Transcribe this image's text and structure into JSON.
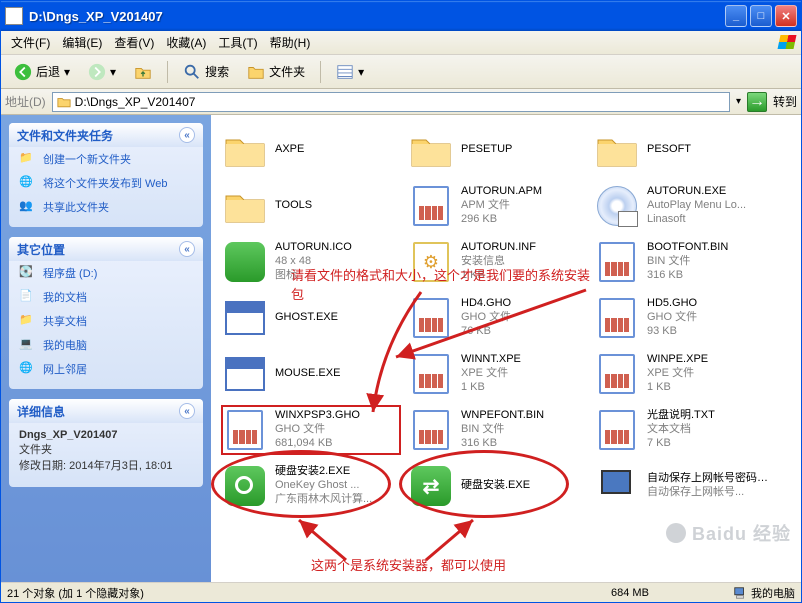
{
  "window": {
    "title": "D:\\Dngs_XP_V201407"
  },
  "menu": {
    "file": "文件(F)",
    "edit": "编辑(E)",
    "view": "查看(V)",
    "favorites": "收藏(A)",
    "tools": "工具(T)",
    "help": "帮助(H)"
  },
  "toolbar": {
    "back": "后退",
    "search": "搜索",
    "folders": "文件夹"
  },
  "address": {
    "label": "地址(D)",
    "path": "D:\\Dngs_XP_V201407",
    "go": "转到"
  },
  "sidebar": {
    "tasks": {
      "title": "文件和文件夹任务",
      "items": [
        "创建一个新文件夹",
        "将这个文件夹发布到 Web",
        "共享此文件夹"
      ]
    },
    "other": {
      "title": "其它位置",
      "items": [
        "程序盘 (D:)",
        "我的文档",
        "共享文档",
        "我的电脑",
        "网上邻居"
      ]
    },
    "detail": {
      "title": "详细信息",
      "name": "Dngs_XP_V201407",
      "type": "文件夹",
      "mod_label": "修改日期:",
      "mod_value": "2014年7月3日, 18:01"
    }
  },
  "items": [
    {
      "icon": "folder",
      "name": "AXPE",
      "sub1": "",
      "sub2": ""
    },
    {
      "icon": "folder",
      "name": "PESETUP",
      "sub1": "",
      "sub2": ""
    },
    {
      "icon": "folder",
      "name": "PESOFT",
      "sub1": "",
      "sub2": ""
    },
    {
      "icon": "folder",
      "name": "TOOLS",
      "sub1": "",
      "sub2": ""
    },
    {
      "icon": "file",
      "name": "AUTORUN.APM",
      "sub1": "APM 文件",
      "sub2": "296 KB"
    },
    {
      "icon": "disc",
      "name": "AUTORUN.EXE",
      "sub1": "AutoPlay Menu Lo...",
      "sub2": "Linasoft"
    },
    {
      "icon": "ico-green",
      "name": "AUTORUN.ICO",
      "sub1": "48 x 48",
      "sub2": "图标"
    },
    {
      "icon": "file-yellow",
      "name": "AUTORUN.INF",
      "sub1": "安装信息",
      "sub2": "1 KB"
    },
    {
      "icon": "file",
      "name": "BOOTFONT.BIN",
      "sub1": "BIN 文件",
      "sub2": "316 KB"
    },
    {
      "icon": "exe",
      "name": "GHOST.EXE",
      "sub1": "",
      "sub2": ""
    },
    {
      "icon": "file",
      "name": "HD4.GHO",
      "sub1": "GHO 文件",
      "sub2": "76 KB"
    },
    {
      "icon": "file",
      "name": "HD5.GHO",
      "sub1": "GHO 文件",
      "sub2": "93 KB"
    },
    {
      "icon": "exe",
      "name": "MOUSE.EXE",
      "sub1": "",
      "sub2": ""
    },
    {
      "icon": "file",
      "name": "WINNT.XPE",
      "sub1": "XPE 文件",
      "sub2": "1 KB"
    },
    {
      "icon": "file",
      "name": "WINPE.XPE",
      "sub1": "XPE 文件",
      "sub2": "1 KB"
    },
    {
      "icon": "file",
      "name": "WINXPSP3.GHO",
      "sub1": "GHO 文件",
      "sub2": "681,094 KB",
      "selected": true
    },
    {
      "icon": "file",
      "name": "WNPEFONT.BIN",
      "sub1": "BIN 文件",
      "sub2": "316 KB"
    },
    {
      "icon": "file",
      "name": "光盘说明.TXT",
      "sub1": "文本文档",
      "sub2": "7 KB"
    },
    {
      "icon": "green-ok",
      "name": "硬盘安装2.EXE",
      "sub1": "OneKey Ghost ...",
      "sub2": "广东雨林木风计算..."
    },
    {
      "icon": "green-arrows",
      "name": "硬盘安装.EXE",
      "sub1": "",
      "sub2": ""
    },
    {
      "icon": "comp",
      "name": "自动保存上网帐号密码到U盘.EXE",
      "sub1": "自动保存上网帐号...",
      "sub2": ""
    }
  ],
  "annotations": {
    "top": "请看文件的格式和大小，这个才是我们要的系统安装包",
    "bottom": "这两个是系统安装器，都可以使用"
  },
  "status": {
    "left": "21 个对象 (加 1 个隐藏对象)",
    "mid": "684 MB",
    "right": "我的电脑"
  },
  "watermark": "Baidu 经验"
}
